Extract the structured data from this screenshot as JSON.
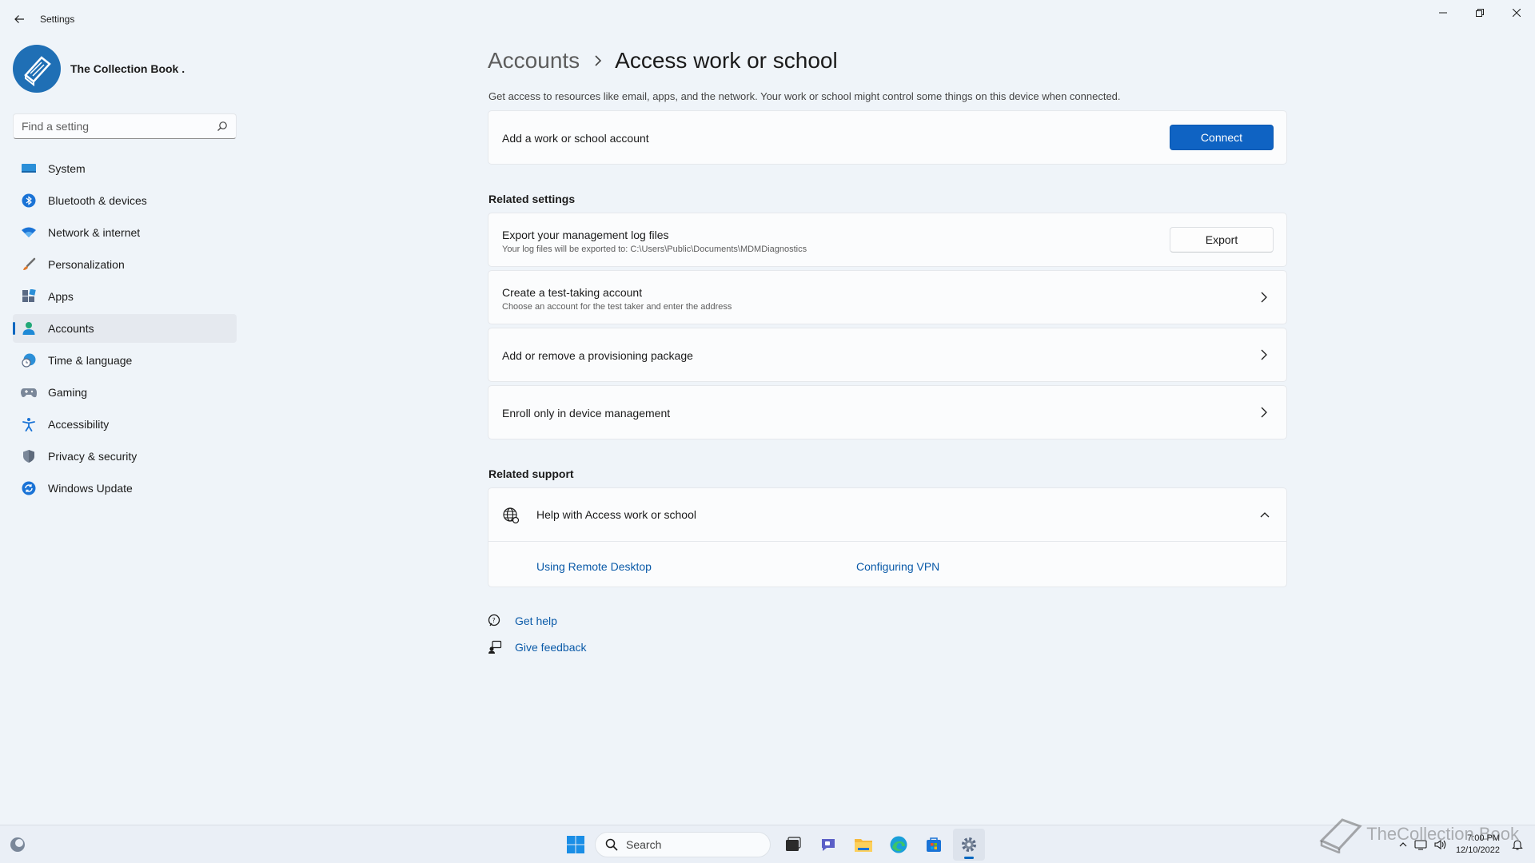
{
  "window": {
    "app_title": "Settings"
  },
  "profile": {
    "name": "The Collection Book ."
  },
  "search": {
    "placeholder": "Find a setting"
  },
  "nav": {
    "items": [
      {
        "label": "System",
        "icon": "system-icon"
      },
      {
        "label": "Bluetooth & devices",
        "icon": "bluetooth-icon"
      },
      {
        "label": "Network & internet",
        "icon": "wifi-icon"
      },
      {
        "label": "Personalization",
        "icon": "brush-icon"
      },
      {
        "label": "Apps",
        "icon": "apps-icon"
      },
      {
        "label": "Accounts",
        "icon": "accounts-icon",
        "active": true
      },
      {
        "label": "Time & language",
        "icon": "clock-globe-icon"
      },
      {
        "label": "Gaming",
        "icon": "gamepad-icon"
      },
      {
        "label": "Accessibility",
        "icon": "accessibility-icon"
      },
      {
        "label": "Privacy & security",
        "icon": "shield-icon"
      },
      {
        "label": "Windows Update",
        "icon": "update-icon"
      }
    ]
  },
  "breadcrumb": {
    "parent": "Accounts",
    "current": "Access work or school"
  },
  "description": "Get access to resources like email, apps, and the network. Your work or school might control some things on this device when connected.",
  "add_account": {
    "title": "Add a work or school account",
    "button": "Connect"
  },
  "related_settings": {
    "header": "Related settings",
    "export": {
      "title": "Export your management log files",
      "subtitle": "Your log files will be exported to: C:\\Users\\Public\\Documents\\MDMDiagnostics",
      "button": "Export"
    },
    "test_account": {
      "title": "Create a test-taking account",
      "subtitle": "Choose an account for the test taker and enter the address"
    },
    "provisioning": {
      "title": "Add or remove a provisioning package"
    },
    "enroll": {
      "title": "Enroll only in device management"
    }
  },
  "related_support": {
    "header": "Related support",
    "help_title": "Help with Access work or school",
    "links": [
      "Using Remote Desktop",
      "Configuring VPN"
    ]
  },
  "footer": {
    "get_help": "Get help",
    "give_feedback": "Give feedback"
  },
  "taskbar": {
    "search_label": "Search",
    "time": "7:00 PM",
    "date": "12/10/2022"
  },
  "watermark": "TheCollection Book",
  "colors": {
    "accent": "#0067c0",
    "primary_button": "#0f63c3",
    "link": "#0a5aa8",
    "background": "#eff4f9"
  }
}
